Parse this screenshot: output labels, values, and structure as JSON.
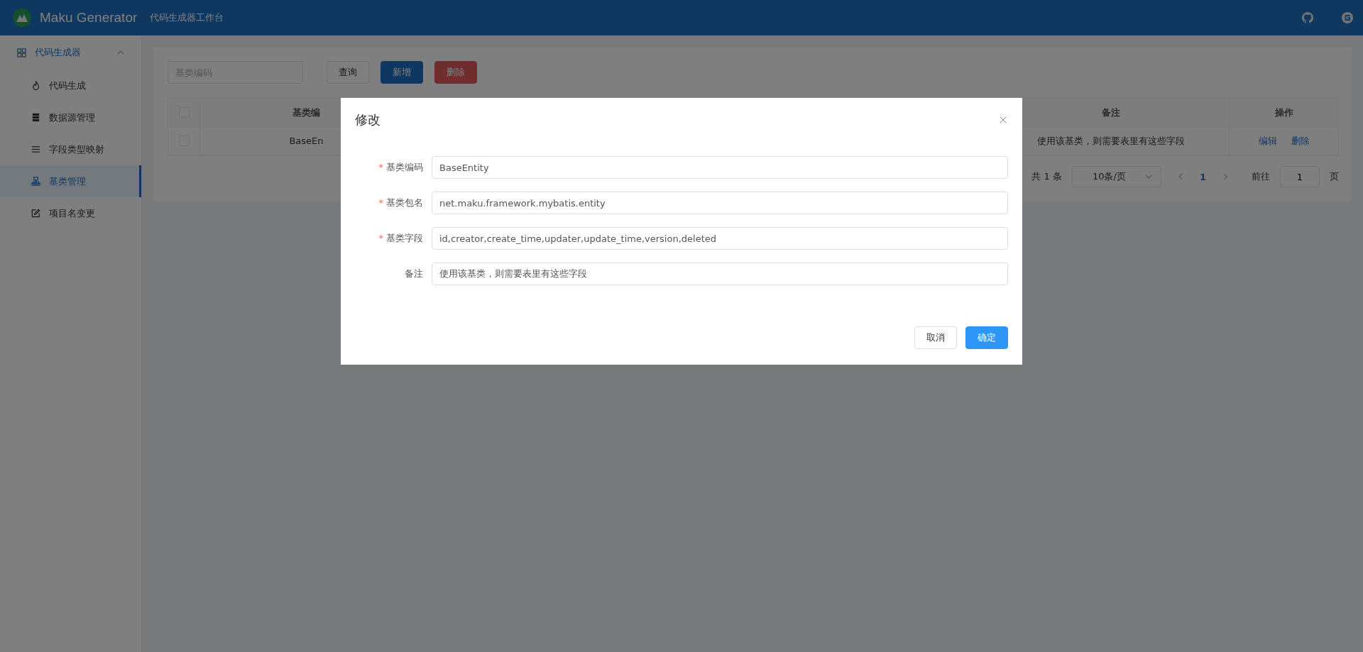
{
  "header": {
    "title": "Maku Generator",
    "subtitle": "代码生成器工作台"
  },
  "sidebar": {
    "items": [
      {
        "label": "代码生成器",
        "expanded": true,
        "children": [
          {
            "label": "代码生成",
            "kind": "flame",
            "selected": false
          },
          {
            "label": "数据源管理",
            "kind": "database",
            "selected": false
          },
          {
            "label": "字段类型映射",
            "kind": "list",
            "selected": false
          },
          {
            "label": "基类管理",
            "kind": "hierarchy",
            "selected": true
          },
          {
            "label": "项目名变更",
            "kind": "edit",
            "selected": false
          }
        ]
      }
    ]
  },
  "toolbar": {
    "search_placeholder": "基类编码",
    "buttons": [
      {
        "label": "查询",
        "kind": "default"
      },
      {
        "label": "新增",
        "kind": "primary"
      },
      {
        "label": "删除",
        "kind": "danger"
      }
    ]
  },
  "table": {
    "header_checked": false,
    "columns": [
      "基类编",
      "备注",
      "操作"
    ],
    "rows": [
      {
        "checked": false,
        "cells": [
          "BaseEn",
          "使用该基类，则需要表里有这些字段"
        ],
        "actions": [
          "编辑",
          "删除"
        ]
      }
    ]
  },
  "pagination": {
    "total": "共 1 条",
    "page_size": "10条/页",
    "pages": [
      {
        "label": "1",
        "selected": true
      }
    ],
    "goto_label": "前往",
    "goto_value": "1",
    "page_suffix": "页"
  },
  "dialog": {
    "title": "修改",
    "fields": [
      {
        "label": "基类编码",
        "required_mark": "*",
        "value": "BaseEntity"
      },
      {
        "label": "基类包名",
        "required_mark": "*",
        "value": "net.maku.framework.mybatis.entity"
      },
      {
        "label": "基类字段",
        "required_mark": "*",
        "value": "id,creator,create_time,updater,update_time,version,deleted"
      },
      {
        "label": "备注",
        "value": "使用该基类，则需要表里有这些字段"
      }
    ],
    "buttons": [
      {
        "label": "取消",
        "kind": "default"
      },
      {
        "label": "确定",
        "kind": "primary"
      }
    ]
  }
}
